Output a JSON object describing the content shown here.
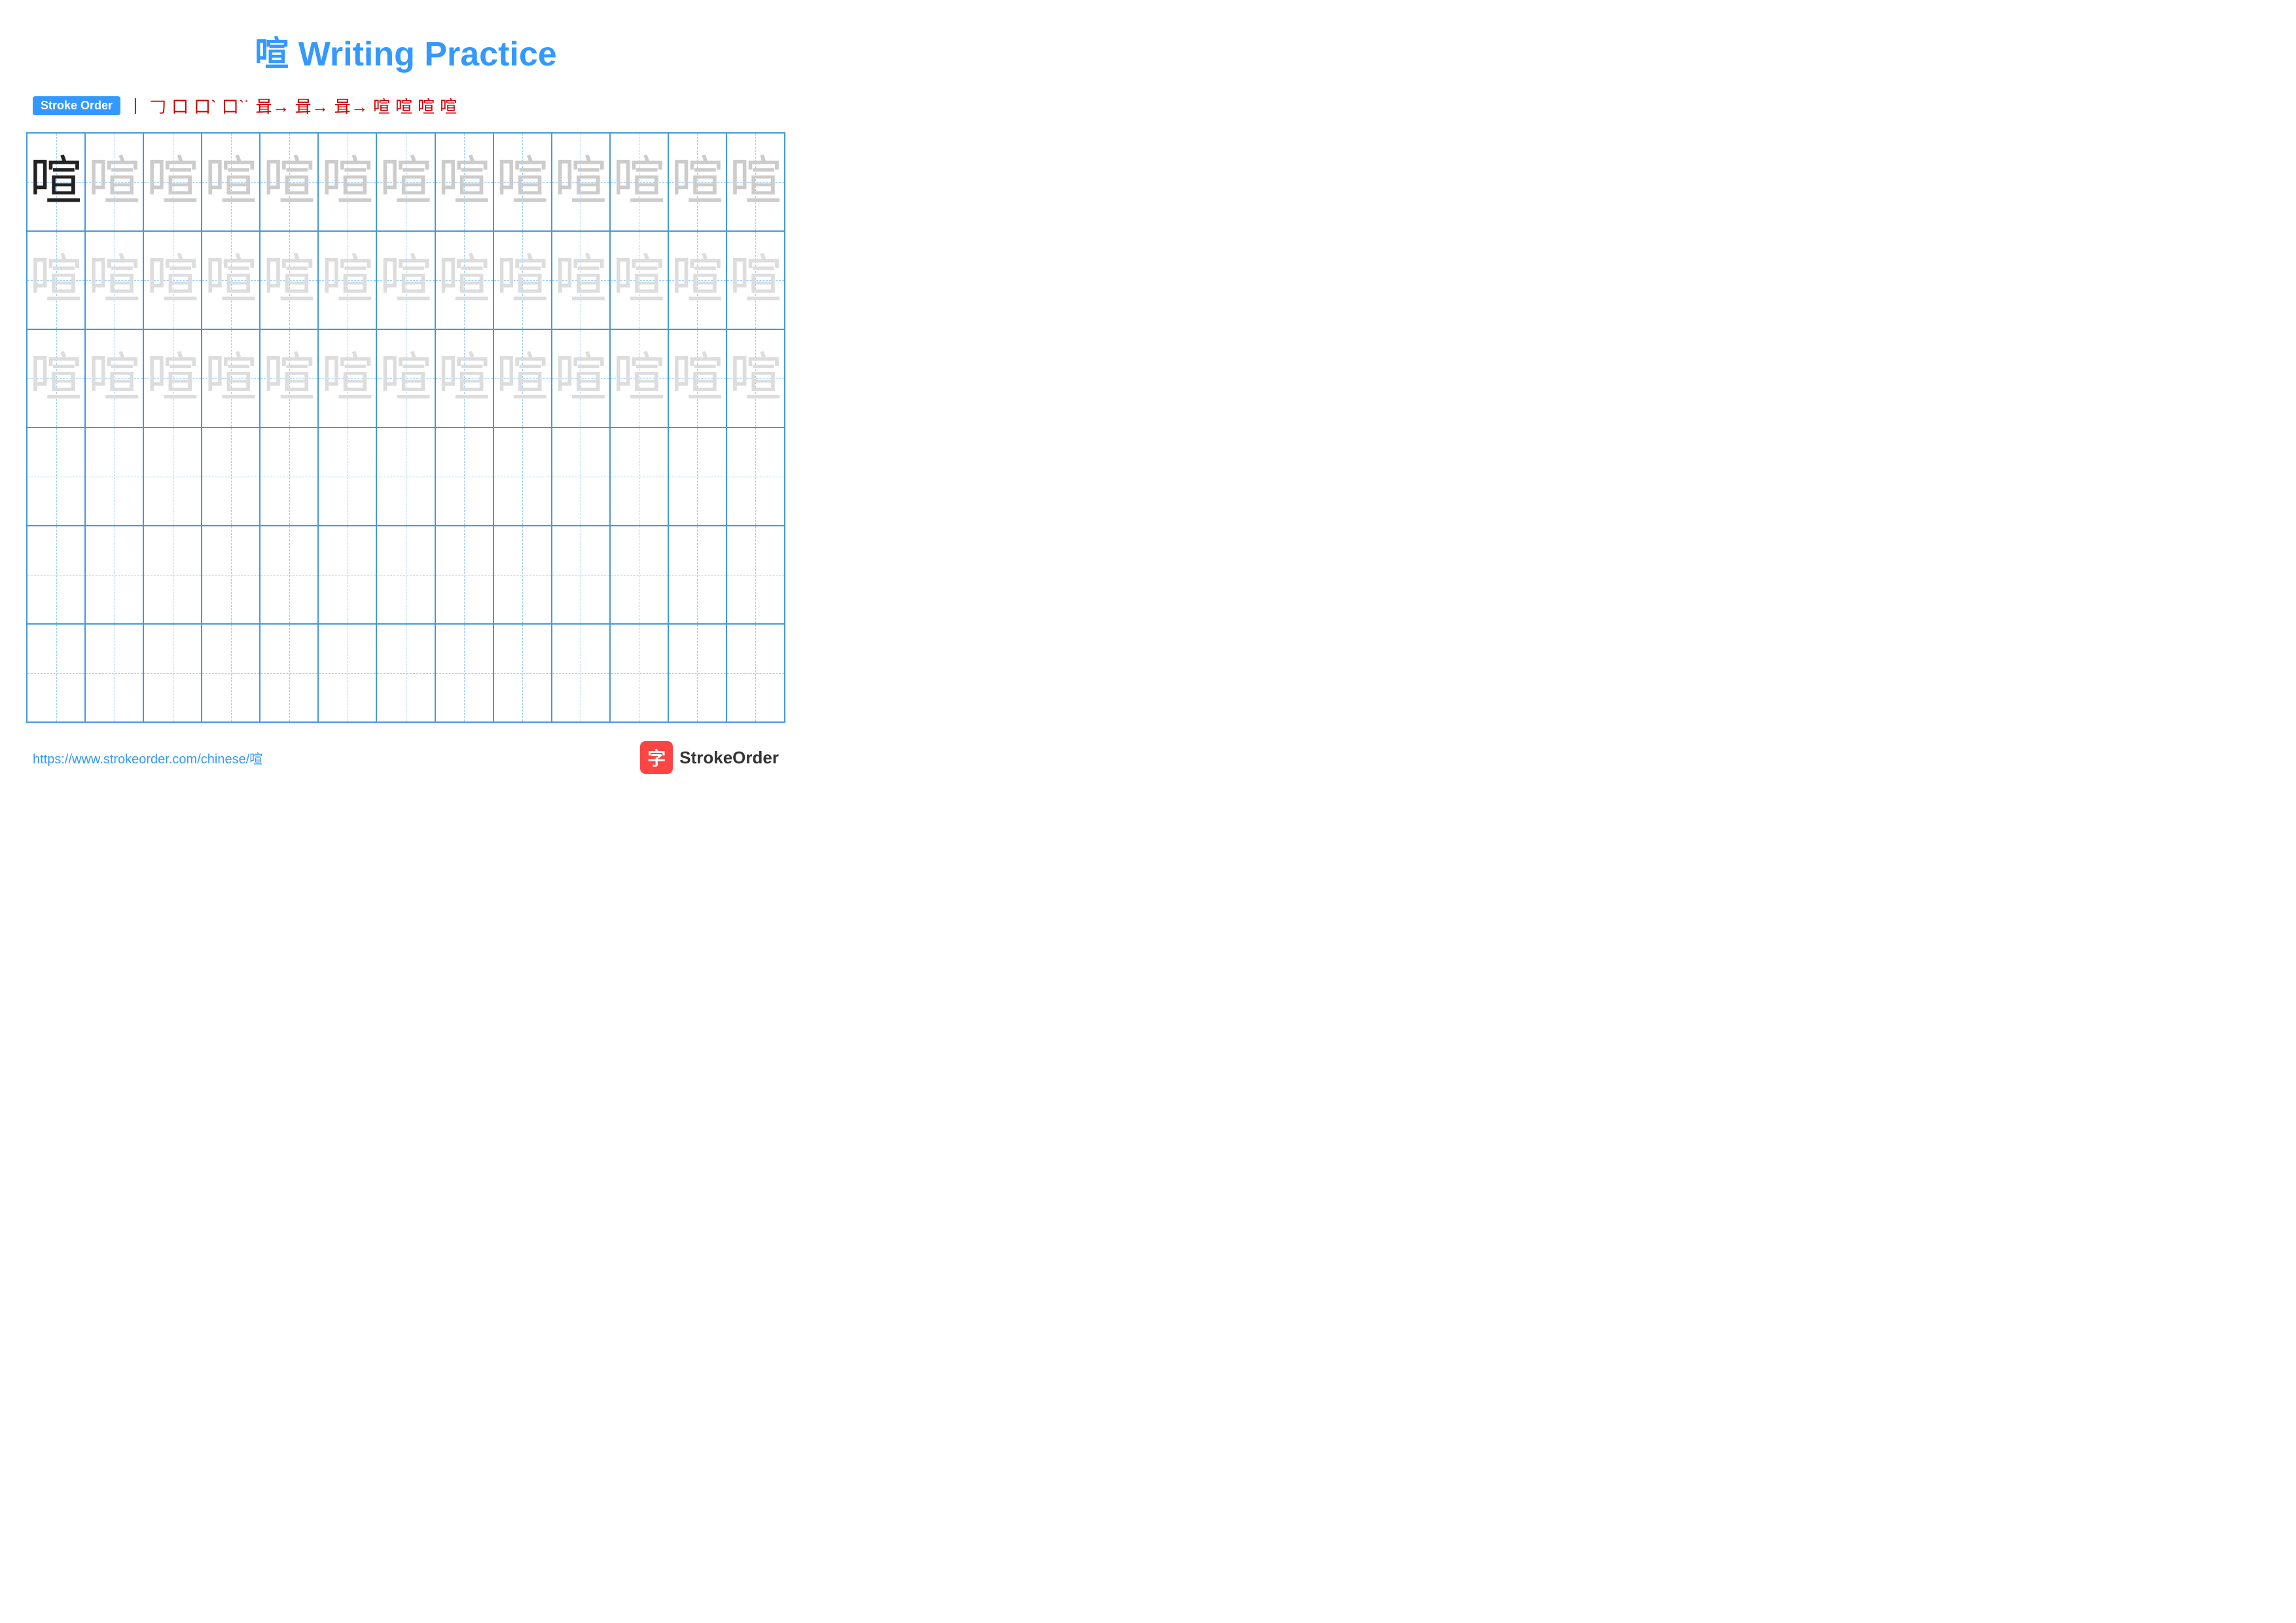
{
  "title": "喧 Writing Practice",
  "stroke_order": {
    "badge_label": "Stroke Order",
    "strokes": [
      "丨",
      "𠃌",
      "口",
      "口˙",
      "口˙˙",
      "咠→",
      "咠→",
      "咠→",
      "喧̣",
      "喧̣",
      "喧̣",
      "喧"
    ]
  },
  "character": "喧",
  "grid": {
    "rows": 6,
    "cols": 13
  },
  "footer": {
    "url": "https://www.strokeorder.com/chinese/喧",
    "logo_text": "StrokeOrder",
    "logo_char": "字"
  }
}
